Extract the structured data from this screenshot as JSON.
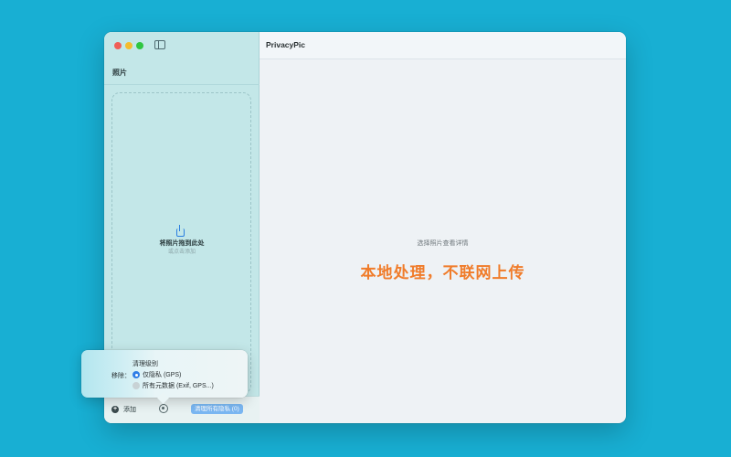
{
  "sidebar": {
    "section_title": "照片",
    "drop_title": "将照片拖到此处",
    "drop_subtitle": "或点击添加",
    "add_label": "添加",
    "clean_button_label": "清理所有隐私 (0)"
  },
  "main": {
    "app_title": "PrivacyPic",
    "hint": "选择照片查看详情",
    "slogan": "本地处理，不联网上传"
  },
  "popover": {
    "title": "清理级别",
    "remove_label": "移除：",
    "options": [
      {
        "label": "仅隐私 (GPS)",
        "selected": true
      },
      {
        "label": "所有元数据 (Exif, GPS...)",
        "selected": false
      }
    ]
  },
  "colors": {
    "background": "#18afd3",
    "sidebar": "#c3e7e8",
    "accent_orange": "#f07c2a",
    "accent_blue": "#2f7ee6"
  }
}
